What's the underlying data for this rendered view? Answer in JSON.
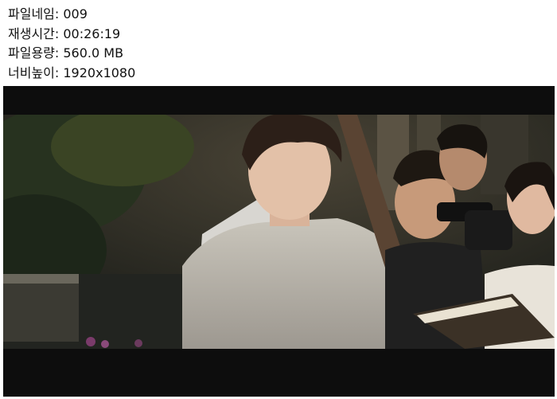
{
  "file_info": {
    "filename_label": "파일네임:",
    "filename_value": "009",
    "duration_label": "재생시간:",
    "duration_value": "00:26:19",
    "filesize_label": "파일용량:",
    "filesize_value": "560.0 MB",
    "resolution_label": "너비높이:",
    "resolution_value": "1920x1080"
  },
  "video": {
    "letterbox_color": "#0d0d0d"
  }
}
